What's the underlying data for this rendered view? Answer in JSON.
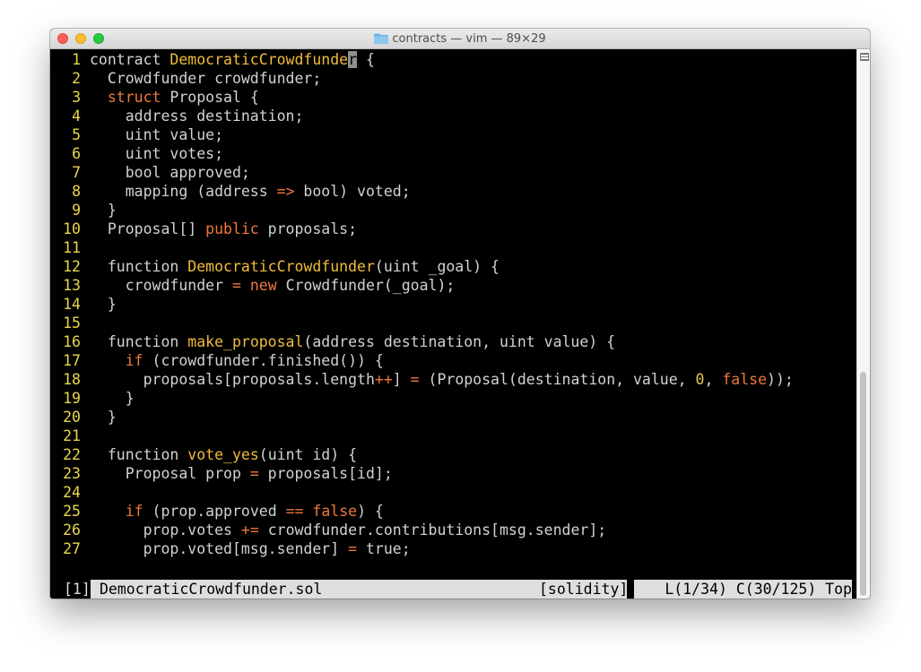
{
  "window": {
    "title": "contracts — vim — 89×29",
    "colors": {
      "keyword": "#f0783c",
      "function": "#f0bc3c",
      "number": "#e8c84a",
      "text": "#d2d2d2",
      "line_number": "#e8d84a",
      "background": "#000000"
    }
  },
  "editor": {
    "lines": [
      {
        "n": "1",
        "tokens": [
          [
            "contract ",
            ""
          ],
          [
            "DemocraticCrowdfunde",
            "f"
          ],
          [
            "r",
            "cursor"
          ],
          [
            " {",
            ""
          ]
        ]
      },
      {
        "n": "2",
        "tokens": [
          [
            "  Crowdfunder crowdfunder;",
            ""
          ]
        ]
      },
      {
        "n": "3",
        "tokens": [
          [
            "  ",
            ""
          ],
          [
            "struct",
            "k"
          ],
          [
            " Proposal {",
            ""
          ]
        ]
      },
      {
        "n": "4",
        "tokens": [
          [
            "    address destination;",
            ""
          ]
        ]
      },
      {
        "n": "5",
        "tokens": [
          [
            "    uint value;",
            ""
          ]
        ]
      },
      {
        "n": "6",
        "tokens": [
          [
            "    uint votes;",
            ""
          ]
        ]
      },
      {
        "n": "7",
        "tokens": [
          [
            "    bool approved;",
            ""
          ]
        ]
      },
      {
        "n": "8",
        "tokens": [
          [
            "    mapping (address ",
            ""
          ],
          [
            "=>",
            "k"
          ],
          [
            " bool) voted;",
            ""
          ]
        ]
      },
      {
        "n": "9",
        "tokens": [
          [
            "  }",
            ""
          ]
        ]
      },
      {
        "n": "10",
        "tokens": [
          [
            "  Proposal[] ",
            ""
          ],
          [
            "public",
            "k"
          ],
          [
            " proposals;",
            ""
          ]
        ]
      },
      {
        "n": "11",
        "tokens": []
      },
      {
        "n": "12",
        "tokens": [
          [
            "  function ",
            ""
          ],
          [
            "DemocraticCrowdfunder",
            "f"
          ],
          [
            "(uint _goal) {",
            ""
          ]
        ]
      },
      {
        "n": "13",
        "tokens": [
          [
            "    crowdfunder ",
            ""
          ],
          [
            "=",
            "k"
          ],
          [
            " ",
            ""
          ],
          [
            "new",
            "k"
          ],
          [
            " Crowdfunder(_goal);",
            ""
          ]
        ]
      },
      {
        "n": "14",
        "tokens": [
          [
            "  }",
            ""
          ]
        ]
      },
      {
        "n": "15",
        "tokens": []
      },
      {
        "n": "16",
        "tokens": [
          [
            "  function ",
            ""
          ],
          [
            "make_proposal",
            "f"
          ],
          [
            "(address destination, uint value) {",
            ""
          ]
        ]
      },
      {
        "n": "17",
        "tokens": [
          [
            "    ",
            ""
          ],
          [
            "if",
            "k"
          ],
          [
            " (crowdfunder.finished()) {",
            ""
          ]
        ]
      },
      {
        "n": "18",
        "tokens": [
          [
            "      proposals[proposals.length",
            ""
          ],
          [
            "++",
            "k"
          ],
          [
            "] ",
            ""
          ],
          [
            "=",
            "k"
          ],
          [
            " (Proposal(destination, value, ",
            ""
          ],
          [
            "0",
            "n"
          ],
          [
            ", ",
            ""
          ],
          [
            "false",
            "k"
          ],
          [
            "));",
            ""
          ]
        ]
      },
      {
        "n": "19",
        "tokens": [
          [
            "    }",
            ""
          ]
        ]
      },
      {
        "n": "20",
        "tokens": [
          [
            "  }",
            ""
          ]
        ]
      },
      {
        "n": "21",
        "tokens": []
      },
      {
        "n": "22",
        "tokens": [
          [
            "  function ",
            ""
          ],
          [
            "vote_yes",
            "f"
          ],
          [
            "(uint id) {",
            ""
          ]
        ]
      },
      {
        "n": "23",
        "tokens": [
          [
            "    Proposal prop ",
            ""
          ],
          [
            "=",
            "k"
          ],
          [
            " proposals[id];",
            ""
          ]
        ]
      },
      {
        "n": "24",
        "tokens": []
      },
      {
        "n": "25",
        "tokens": [
          [
            "    ",
            ""
          ],
          [
            "if",
            "k"
          ],
          [
            " (prop.approved ",
            ""
          ],
          [
            "==",
            "k"
          ],
          [
            " ",
            ""
          ],
          [
            "false",
            "k"
          ],
          [
            ") {",
            ""
          ]
        ]
      },
      {
        "n": "26",
        "tokens": [
          [
            "      prop.votes ",
            ""
          ],
          [
            "+=",
            "k"
          ],
          [
            " crowdfunder.contributions[msg.sender];",
            ""
          ]
        ]
      },
      {
        "n": "27",
        "tokens": [
          [
            "      prop.voted[msg.sender] ",
            ""
          ],
          [
            "=",
            "k"
          ],
          [
            " true;",
            ""
          ]
        ]
      }
    ]
  },
  "statusbar": {
    "buffer": "[1]",
    "filename": "DemocraticCrowdfunder.sol",
    "filetype": "[solidity]",
    "position": "L(1/34) C(30/125) Top"
  }
}
